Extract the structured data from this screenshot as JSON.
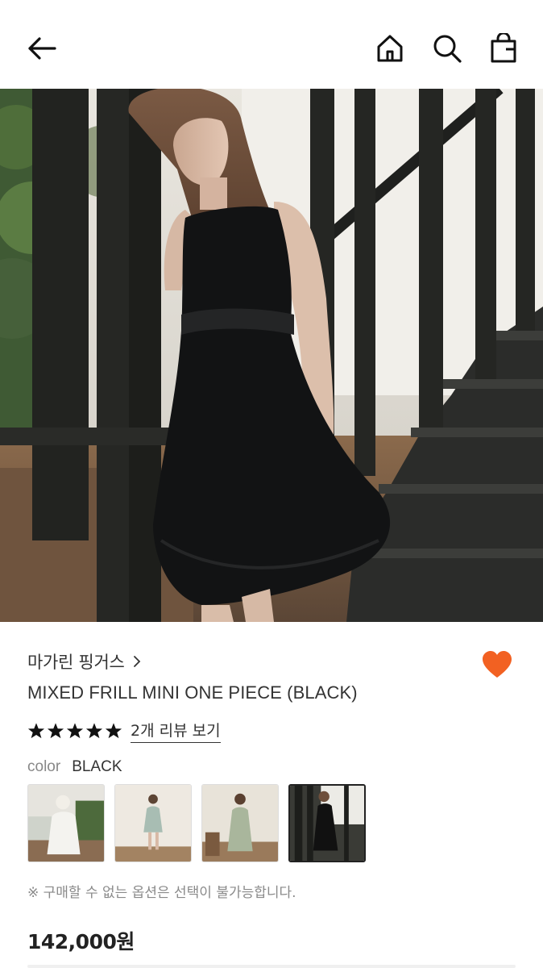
{
  "header": {
    "back_icon": "arrow-left-icon",
    "home_icon": "home-icon",
    "search_icon": "search-icon",
    "bag_icon": "shopping-bag-icon"
  },
  "product": {
    "brand": "마가린 핑거스",
    "brand_chevron": "›",
    "title": "MIXED FRILL MINI ONE PIECE (BLACK)",
    "rating_stars": 5,
    "review_link": "2개 리뷰 보기",
    "color_label": "color",
    "color_value": "BLACK",
    "swatch_count": 4,
    "selected_swatch": 4,
    "notice": "※ 구매할 수 없는 옵션은 선택이 불가능합니다.",
    "price": "142,000원"
  },
  "colors": {
    "heart": "#f26122",
    "star": "#111111",
    "text": "#333333",
    "muted": "#888888"
  }
}
